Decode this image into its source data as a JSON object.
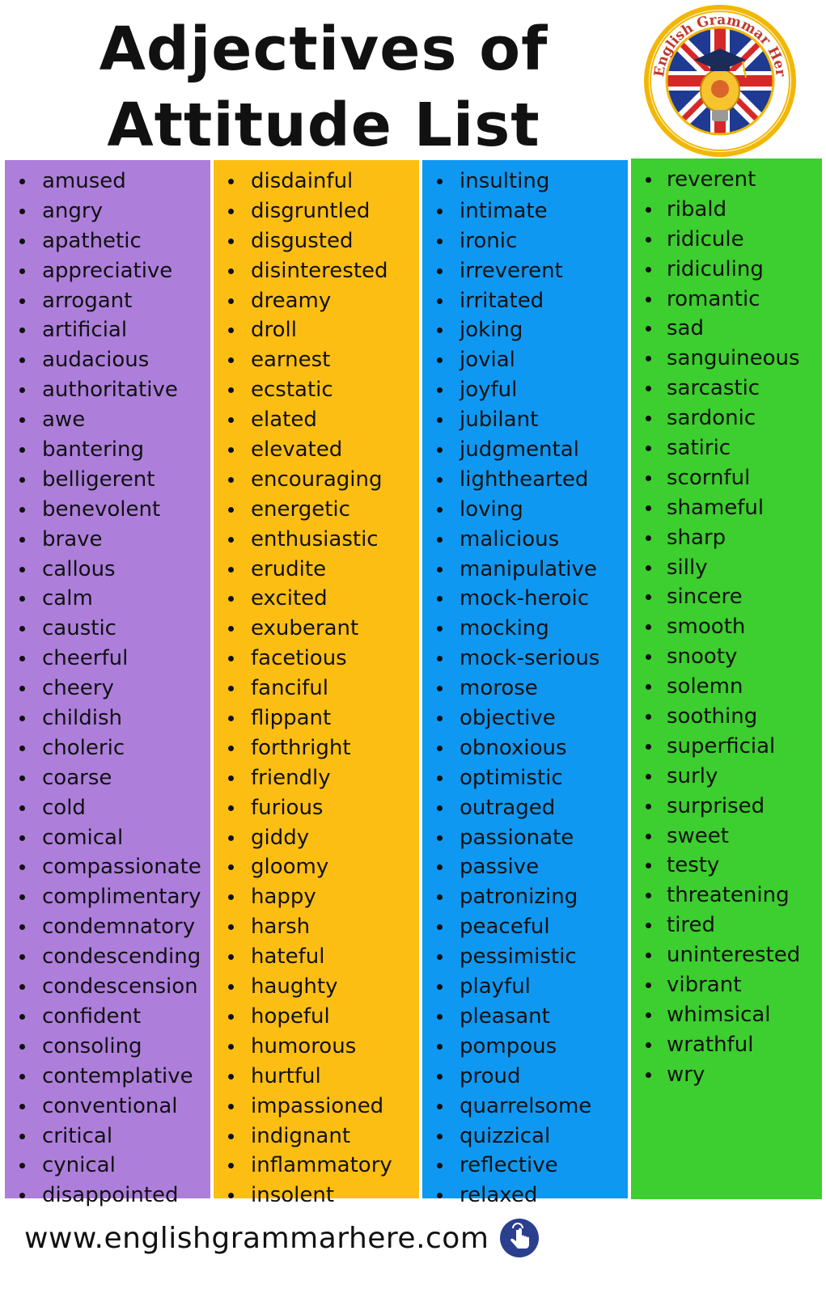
{
  "title": {
    "line1": "Adjectives of",
    "line2": "Attitude List"
  },
  "logo": {
    "text": "English Grammar Here.Com",
    "icon": "graduation-bulb-flag-logo"
  },
  "columns": [
    {
      "color": "#ad7fdb",
      "items": [
        "amused",
        "angry",
        "apathetic",
        "appreciative",
        "arrogant",
        "artificial",
        "audacious",
        "authoritative",
        "awe",
        "bantering",
        "belligerent",
        "benevolent",
        "brave",
        "callous",
        "calm",
        "caustic",
        "cheerful",
        "cheery",
        "childish",
        "choleric",
        "coarse",
        "cold",
        "comical",
        "compassionate",
        "complimentary",
        "condemnatory",
        "condescending",
        "condescension",
        "confident",
        "consoling",
        "contemplative",
        "conventional",
        "critical",
        "cynical",
        "disappointed"
      ]
    },
    {
      "color": "#fdbe14",
      "items": [
        "disdainful",
        "disgruntled",
        "disgusted",
        "disinterested",
        "dreamy",
        "droll",
        "earnest",
        "ecstatic",
        "elated",
        "elevated",
        "encouraging",
        "energetic",
        "enthusiastic",
        "erudite",
        "excited",
        "exuberant",
        "facetious",
        "fanciful",
        "flippant",
        "forthright",
        "friendly",
        "furious",
        "giddy",
        "gloomy",
        "happy",
        "harsh",
        "hateful",
        "haughty",
        "hopeful",
        "humorous",
        "hurtful",
        "impassioned",
        "indignant",
        "inflammatory",
        "insolent"
      ]
    },
    {
      "color": "#0f98f2",
      "items": [
        "insulting",
        "intimate",
        "ironic",
        "irreverent",
        "irritated",
        "joking",
        "jovial",
        "joyful",
        "jubilant",
        "judgmental",
        "lighthearted",
        "loving",
        "malicious",
        "manipulative",
        "mock-heroic",
        "mocking",
        "mock-serious",
        "morose",
        "objective",
        "obnoxious",
        "optimistic",
        "outraged",
        "passionate",
        "passive",
        "patronizing",
        "peaceful",
        "pessimistic",
        "playful",
        "pleasant",
        "pompous",
        "proud",
        "quarrelsome",
        "quizzical",
        "reflective",
        "relaxed"
      ]
    },
    {
      "color": "#3dce2f",
      "items": [
        "reverent",
        "ribald",
        "ridicule",
        "ridiculing",
        "romantic",
        "sad",
        "sanguineous",
        "sarcastic",
        "sardonic",
        "satiric",
        "scornful",
        "shameful",
        "sharp",
        "silly",
        "sincere",
        "smooth",
        "snooty",
        "solemn",
        "soothing",
        "superficial",
        "surly",
        "surprised",
        "sweet",
        "testy",
        "threatening",
        "tired",
        "uninterested",
        "vibrant",
        "whimsical",
        "wrathful",
        "wry"
      ]
    }
  ],
  "footer": {
    "url": "www.englishgrammarhere.com",
    "icon": "pointing-hand-icon"
  }
}
